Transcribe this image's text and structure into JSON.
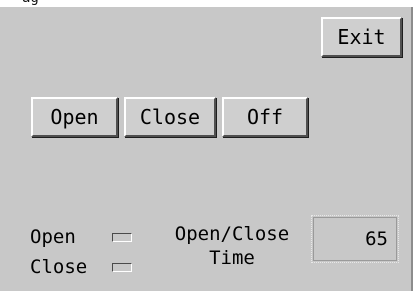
{
  "window": {
    "top_fragment": "ag"
  },
  "buttons": {
    "exit": "Exit",
    "open": "Open",
    "close": "Close",
    "off": "Off"
  },
  "indicators": [
    {
      "label": "Open"
    },
    {
      "label": "Close"
    }
  ],
  "timer": {
    "caption_line1": "Open/Close",
    "caption_line2": "Time",
    "value": "65"
  },
  "colors": {
    "panel": "#c8c8c8",
    "button": "#cfcfcf",
    "text": "#000000"
  }
}
